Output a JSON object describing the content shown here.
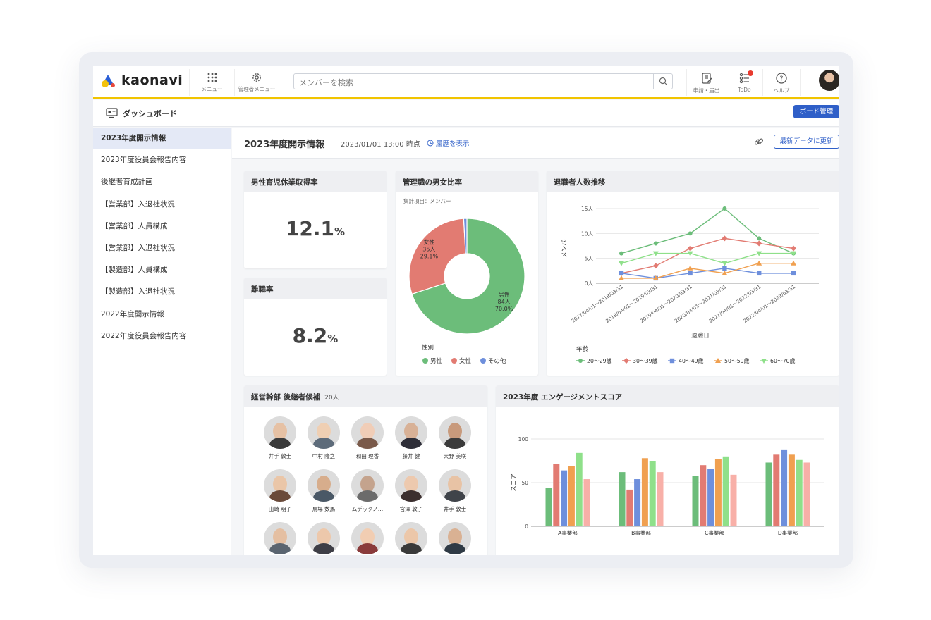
{
  "app": {
    "logo_text": "kaonavi"
  },
  "header": {
    "menu_label": "メニュー",
    "admin_menu_label": "管理者メニュー",
    "search_placeholder": "メンバーを検索",
    "apply_label": "申請・届出",
    "todo_label": "ToDo",
    "help_label": "ヘルプ"
  },
  "subheader": {
    "title": "ダッシュボード",
    "board_button": "ボード管理"
  },
  "sidebar": {
    "items": [
      {
        "label": "2023年度開示情報",
        "active": true
      },
      {
        "label": "2023年度役員会報告内容"
      },
      {
        "label": "後継者育成計画"
      },
      {
        "label": "【営業部】入退社状況"
      },
      {
        "label": "【営業部】人員構成"
      },
      {
        "label": "【営業部】入退社状況"
      },
      {
        "label": "【製造部】人員構成"
      },
      {
        "label": "【製造部】入退社状況"
      },
      {
        "label": "2022年度開示情報"
      },
      {
        "label": "2022年度役員会報告内容"
      }
    ]
  },
  "main": {
    "title": "2023年度開示情報",
    "timestamp": "2023/01/01 13:00 時点",
    "history_link": "履歴を表示",
    "refresh_button": "最新データに更新"
  },
  "cards": {
    "paternity": {
      "title": "男性育児休業取得率",
      "value": "12.1",
      "unit": "%"
    },
    "turnover": {
      "title": "離職率",
      "value": "8.2",
      "unit": "%"
    },
    "gender": {
      "title": "管理職の男女比率",
      "caption": "集計項目：メンバー"
    },
    "retirees": {
      "title": "退職者人数推移"
    },
    "successors": {
      "title": "経営幹部 後継者候補",
      "count": "20人",
      "people": [
        {
          "name": "井手 敦士"
        },
        {
          "name": "中村 隆之"
        },
        {
          "name": "和田 理香"
        },
        {
          "name": "藤井 健"
        },
        {
          "name": "大野 美咲"
        },
        {
          "name": "山崎 明子"
        },
        {
          "name": "馬場 数馬"
        },
        {
          "name": "ムデックノ…"
        },
        {
          "name": "宮澤 敦子"
        },
        {
          "name": "井手 敦士"
        },
        {
          "name": ""
        },
        {
          "name": ""
        },
        {
          "name": ""
        },
        {
          "name": ""
        },
        {
          "name": ""
        }
      ]
    },
    "engagement": {
      "title": "2023年度 エンゲージメントスコア"
    }
  },
  "chart_data": [
    {
      "type": "pie",
      "title": "管理職の男女比率",
      "legend_title": "性別",
      "slices": [
        {
          "label": "男性",
          "count": "84人",
          "value": 70.0,
          "pct_label": "70.0%",
          "color": "#6cbd7a"
        },
        {
          "label": "女性",
          "count": "35人",
          "value": 29.1,
          "pct_label": "29.1%",
          "color": "#e27b72"
        },
        {
          "label": "その他",
          "value": 0.9,
          "color": "#6e8fdc"
        }
      ]
    },
    {
      "type": "line",
      "title": "退職者人数推移",
      "xlabel": "退職日",
      "ylabel": "メンバー",
      "legend_title": "年齢",
      "ylim": [
        0,
        15
      ],
      "yticks": [
        "0人",
        "5人",
        "10人",
        "15人"
      ],
      "categories": [
        "2017/04/01〜2018/03/31",
        "2018/04/01〜2019/03/31",
        "2019/04/01〜2020/03/31",
        "2020/04/01〜2021/03/31",
        "2021/04/01〜2022/03/31",
        "2022/04/01〜2023/03/31"
      ],
      "series": [
        {
          "name": "20〜29歳",
          "color": "#6cbd7a",
          "marker": "circle",
          "values": [
            6,
            8,
            10,
            15,
            9,
            6
          ]
        },
        {
          "name": "30〜39歳",
          "color": "#e27b72",
          "marker": "diamond",
          "values": [
            2,
            3.5,
            7,
            9,
            8,
            7
          ]
        },
        {
          "name": "40〜49歳",
          "color": "#6e8fdc",
          "marker": "square",
          "values": [
            2,
            1,
            2,
            3,
            2,
            2
          ]
        },
        {
          "name": "50〜59歳",
          "color": "#f0a050",
          "marker": "triangle",
          "values": [
            1,
            1,
            3,
            2,
            4,
            4
          ]
        },
        {
          "name": "60〜70歳",
          "color": "#8fe08a",
          "marker": "triangle-down",
          "values": [
            4,
            6,
            6,
            4,
            6,
            6
          ]
        }
      ]
    },
    {
      "type": "bar",
      "title": "2023年度 エンゲージメントスコア",
      "ylabel": "スコア",
      "ylim": [
        0,
        100
      ],
      "yticks": [
        "0",
        "50",
        "100"
      ],
      "categories": [
        "A事業部",
        "B事業部",
        "C事業部",
        "D事業部"
      ],
      "series": [
        {
          "color": "#6cbd7a",
          "values": [
            44,
            62,
            58,
            73
          ]
        },
        {
          "color": "#e27b72",
          "values": [
            71,
            42,
            70,
            82
          ]
        },
        {
          "color": "#6e8fdc",
          "values": [
            64,
            54,
            66,
            88
          ]
        },
        {
          "color": "#f0a050",
          "values": [
            69,
            78,
            77,
            82
          ]
        },
        {
          "color": "#8fe08a",
          "values": [
            84,
            75,
            80,
            76
          ]
        },
        {
          "color": "#f8b0a8",
          "values": [
            54,
            62,
            59,
            73
          ]
        }
      ]
    }
  ]
}
